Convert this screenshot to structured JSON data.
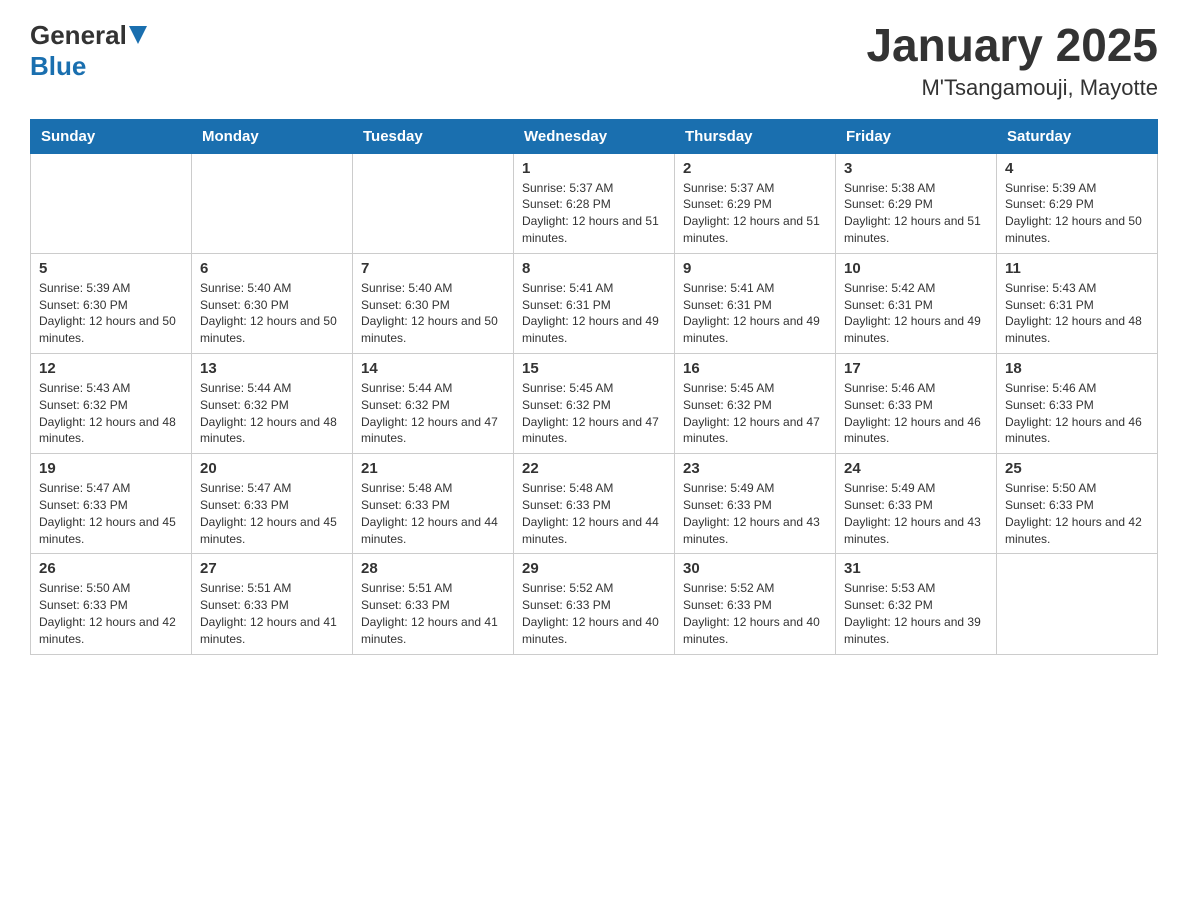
{
  "header": {
    "logo_general": "General",
    "logo_blue": "Blue",
    "title": "January 2025",
    "subtitle": "M'Tsangamouji, Mayotte"
  },
  "days_of_week": [
    "Sunday",
    "Monday",
    "Tuesday",
    "Wednesday",
    "Thursday",
    "Friday",
    "Saturday"
  ],
  "weeks": [
    {
      "cells": [
        {
          "day": null,
          "info": null
        },
        {
          "day": null,
          "info": null
        },
        {
          "day": null,
          "info": null
        },
        {
          "day": "1",
          "info": "Sunrise: 5:37 AM\nSunset: 6:28 PM\nDaylight: 12 hours and 51 minutes."
        },
        {
          "day": "2",
          "info": "Sunrise: 5:37 AM\nSunset: 6:29 PM\nDaylight: 12 hours and 51 minutes."
        },
        {
          "day": "3",
          "info": "Sunrise: 5:38 AM\nSunset: 6:29 PM\nDaylight: 12 hours and 51 minutes."
        },
        {
          "day": "4",
          "info": "Sunrise: 5:39 AM\nSunset: 6:29 PM\nDaylight: 12 hours and 50 minutes."
        }
      ]
    },
    {
      "cells": [
        {
          "day": "5",
          "info": "Sunrise: 5:39 AM\nSunset: 6:30 PM\nDaylight: 12 hours and 50 minutes."
        },
        {
          "day": "6",
          "info": "Sunrise: 5:40 AM\nSunset: 6:30 PM\nDaylight: 12 hours and 50 minutes."
        },
        {
          "day": "7",
          "info": "Sunrise: 5:40 AM\nSunset: 6:30 PM\nDaylight: 12 hours and 50 minutes."
        },
        {
          "day": "8",
          "info": "Sunrise: 5:41 AM\nSunset: 6:31 PM\nDaylight: 12 hours and 49 minutes."
        },
        {
          "day": "9",
          "info": "Sunrise: 5:41 AM\nSunset: 6:31 PM\nDaylight: 12 hours and 49 minutes."
        },
        {
          "day": "10",
          "info": "Sunrise: 5:42 AM\nSunset: 6:31 PM\nDaylight: 12 hours and 49 minutes."
        },
        {
          "day": "11",
          "info": "Sunrise: 5:43 AM\nSunset: 6:31 PM\nDaylight: 12 hours and 48 minutes."
        }
      ]
    },
    {
      "cells": [
        {
          "day": "12",
          "info": "Sunrise: 5:43 AM\nSunset: 6:32 PM\nDaylight: 12 hours and 48 minutes."
        },
        {
          "day": "13",
          "info": "Sunrise: 5:44 AM\nSunset: 6:32 PM\nDaylight: 12 hours and 48 minutes."
        },
        {
          "day": "14",
          "info": "Sunrise: 5:44 AM\nSunset: 6:32 PM\nDaylight: 12 hours and 47 minutes."
        },
        {
          "day": "15",
          "info": "Sunrise: 5:45 AM\nSunset: 6:32 PM\nDaylight: 12 hours and 47 minutes."
        },
        {
          "day": "16",
          "info": "Sunrise: 5:45 AM\nSunset: 6:32 PM\nDaylight: 12 hours and 47 minutes."
        },
        {
          "day": "17",
          "info": "Sunrise: 5:46 AM\nSunset: 6:33 PM\nDaylight: 12 hours and 46 minutes."
        },
        {
          "day": "18",
          "info": "Sunrise: 5:46 AM\nSunset: 6:33 PM\nDaylight: 12 hours and 46 minutes."
        }
      ]
    },
    {
      "cells": [
        {
          "day": "19",
          "info": "Sunrise: 5:47 AM\nSunset: 6:33 PM\nDaylight: 12 hours and 45 minutes."
        },
        {
          "day": "20",
          "info": "Sunrise: 5:47 AM\nSunset: 6:33 PM\nDaylight: 12 hours and 45 minutes."
        },
        {
          "day": "21",
          "info": "Sunrise: 5:48 AM\nSunset: 6:33 PM\nDaylight: 12 hours and 44 minutes."
        },
        {
          "day": "22",
          "info": "Sunrise: 5:48 AM\nSunset: 6:33 PM\nDaylight: 12 hours and 44 minutes."
        },
        {
          "day": "23",
          "info": "Sunrise: 5:49 AM\nSunset: 6:33 PM\nDaylight: 12 hours and 43 minutes."
        },
        {
          "day": "24",
          "info": "Sunrise: 5:49 AM\nSunset: 6:33 PM\nDaylight: 12 hours and 43 minutes."
        },
        {
          "day": "25",
          "info": "Sunrise: 5:50 AM\nSunset: 6:33 PM\nDaylight: 12 hours and 42 minutes."
        }
      ]
    },
    {
      "cells": [
        {
          "day": "26",
          "info": "Sunrise: 5:50 AM\nSunset: 6:33 PM\nDaylight: 12 hours and 42 minutes."
        },
        {
          "day": "27",
          "info": "Sunrise: 5:51 AM\nSunset: 6:33 PM\nDaylight: 12 hours and 41 minutes."
        },
        {
          "day": "28",
          "info": "Sunrise: 5:51 AM\nSunset: 6:33 PM\nDaylight: 12 hours and 41 minutes."
        },
        {
          "day": "29",
          "info": "Sunrise: 5:52 AM\nSunset: 6:33 PM\nDaylight: 12 hours and 40 minutes."
        },
        {
          "day": "30",
          "info": "Sunrise: 5:52 AM\nSunset: 6:33 PM\nDaylight: 12 hours and 40 minutes."
        },
        {
          "day": "31",
          "info": "Sunrise: 5:53 AM\nSunset: 6:32 PM\nDaylight: 12 hours and 39 minutes."
        },
        {
          "day": null,
          "info": null
        }
      ]
    }
  ]
}
